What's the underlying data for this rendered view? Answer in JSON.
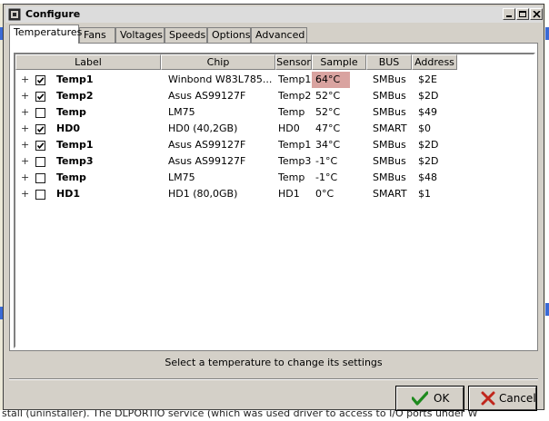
{
  "background": {
    "bottom_text": "stall (uninstaller). The DLPORTIO service (which was used driver to access to I/O ports under W"
  },
  "window": {
    "title": "Configure",
    "controls": [
      "minimize",
      "maximize",
      "close"
    ]
  },
  "tabs": [
    {
      "label": "Temperatures",
      "active": true
    },
    {
      "label": "Fans",
      "active": false
    },
    {
      "label": "Voltages",
      "active": false
    },
    {
      "label": "Speeds",
      "active": false
    },
    {
      "label": "Options",
      "active": false
    },
    {
      "label": "Advanced",
      "active": false
    }
  ],
  "table": {
    "columns": [
      "Label",
      "Chip",
      "Sensor",
      "Sample",
      "BUS",
      "Address"
    ],
    "rows": [
      {
        "checked": true,
        "label": "Temp1",
        "chip": "Winbond W83L785...",
        "sensor": "Temp1",
        "sample": "64°C",
        "bus": "SMBus",
        "address": "$2E",
        "highlight": true
      },
      {
        "checked": true,
        "label": "Temp2",
        "chip": "Asus AS99127F",
        "sensor": "Temp2",
        "sample": "52°C",
        "bus": "SMBus",
        "address": "$2D",
        "highlight": false
      },
      {
        "checked": false,
        "label": "Temp",
        "chip": "LM75",
        "sensor": "Temp",
        "sample": "52°C",
        "bus": "SMBus",
        "address": "$49",
        "highlight": false
      },
      {
        "checked": true,
        "label": "HD0",
        "chip": "HD0 (40,2GB)",
        "sensor": "HD0",
        "sample": "47°C",
        "bus": "SMART",
        "address": "$0",
        "highlight": false
      },
      {
        "checked": true,
        "label": "Temp1",
        "chip": "Asus AS99127F",
        "sensor": "Temp1",
        "sample": "34°C",
        "bus": "SMBus",
        "address": "$2D",
        "highlight": false
      },
      {
        "checked": false,
        "label": "Temp3",
        "chip": "Asus AS99127F",
        "sensor": "Temp3",
        "sample": "-1°C",
        "bus": "SMBus",
        "address": "$2D",
        "highlight": false
      },
      {
        "checked": false,
        "label": "Temp",
        "chip": "LM75",
        "sensor": "Temp",
        "sample": "-1°C",
        "bus": "SMBus",
        "address": "$48",
        "highlight": false
      },
      {
        "checked": false,
        "label": "HD1",
        "chip": "HD1 (80,0GB)",
        "sensor": "HD1",
        "sample": "0°C",
        "bus": "SMART",
        "address": "$1",
        "highlight": false
      }
    ]
  },
  "status_text": "Select a temperature to change its settings",
  "buttons": {
    "ok": {
      "label": "OK",
      "icon": "check-icon"
    },
    "cancel": {
      "label": "Cancel",
      "icon": "x-icon"
    }
  },
  "colors": {
    "highlight": "#d9a3a0",
    "ok_icon": "#1e8a1e",
    "cancel_icon": "#c0261c"
  }
}
